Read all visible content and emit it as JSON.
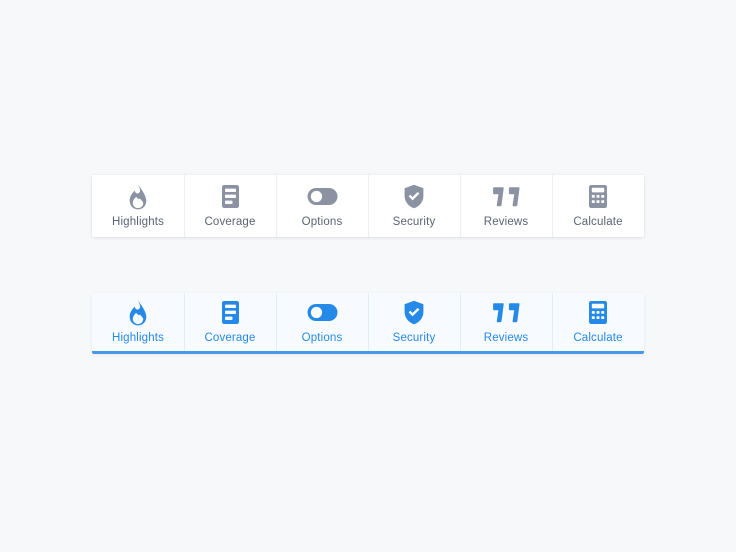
{
  "background_color": "#f7f8f9",
  "tabbars": [
    {
      "id": "default",
      "state": "default",
      "card_background": "#ffffff",
      "icon_color": "#8b93a3",
      "label_color": "#5b6474",
      "divider_color": "#edf0f2",
      "underline": false,
      "tabs": [
        {
          "label": "Highlights",
          "icon": "flame-icon"
        },
        {
          "label": "Coverage",
          "icon": "document-lines-icon"
        },
        {
          "label": "Options",
          "icon": "toggle-switch-icon"
        },
        {
          "label": "Security",
          "icon": "shield-check-icon"
        },
        {
          "label": "Reviews",
          "icon": "quote-marks-icon"
        },
        {
          "label": "Calculate",
          "icon": "calculator-icon"
        }
      ]
    },
    {
      "id": "active",
      "state": "selected",
      "card_background": "#f7fbff",
      "icon_color": "#2589e8",
      "label_color": "#2589e8",
      "divider_color": "#e2edf8",
      "underline": true,
      "underline_color": "#4a9ae8",
      "tabs": [
        {
          "label": "Highlights",
          "icon": "flame-icon"
        },
        {
          "label": "Coverage",
          "icon": "document-lines-icon"
        },
        {
          "label": "Options",
          "icon": "toggle-switch-icon"
        },
        {
          "label": "Security",
          "icon": "shield-check-icon"
        },
        {
          "label": "Reviews",
          "icon": "quote-marks-icon"
        },
        {
          "label": "Calculate",
          "icon": "calculator-icon"
        }
      ]
    }
  ]
}
